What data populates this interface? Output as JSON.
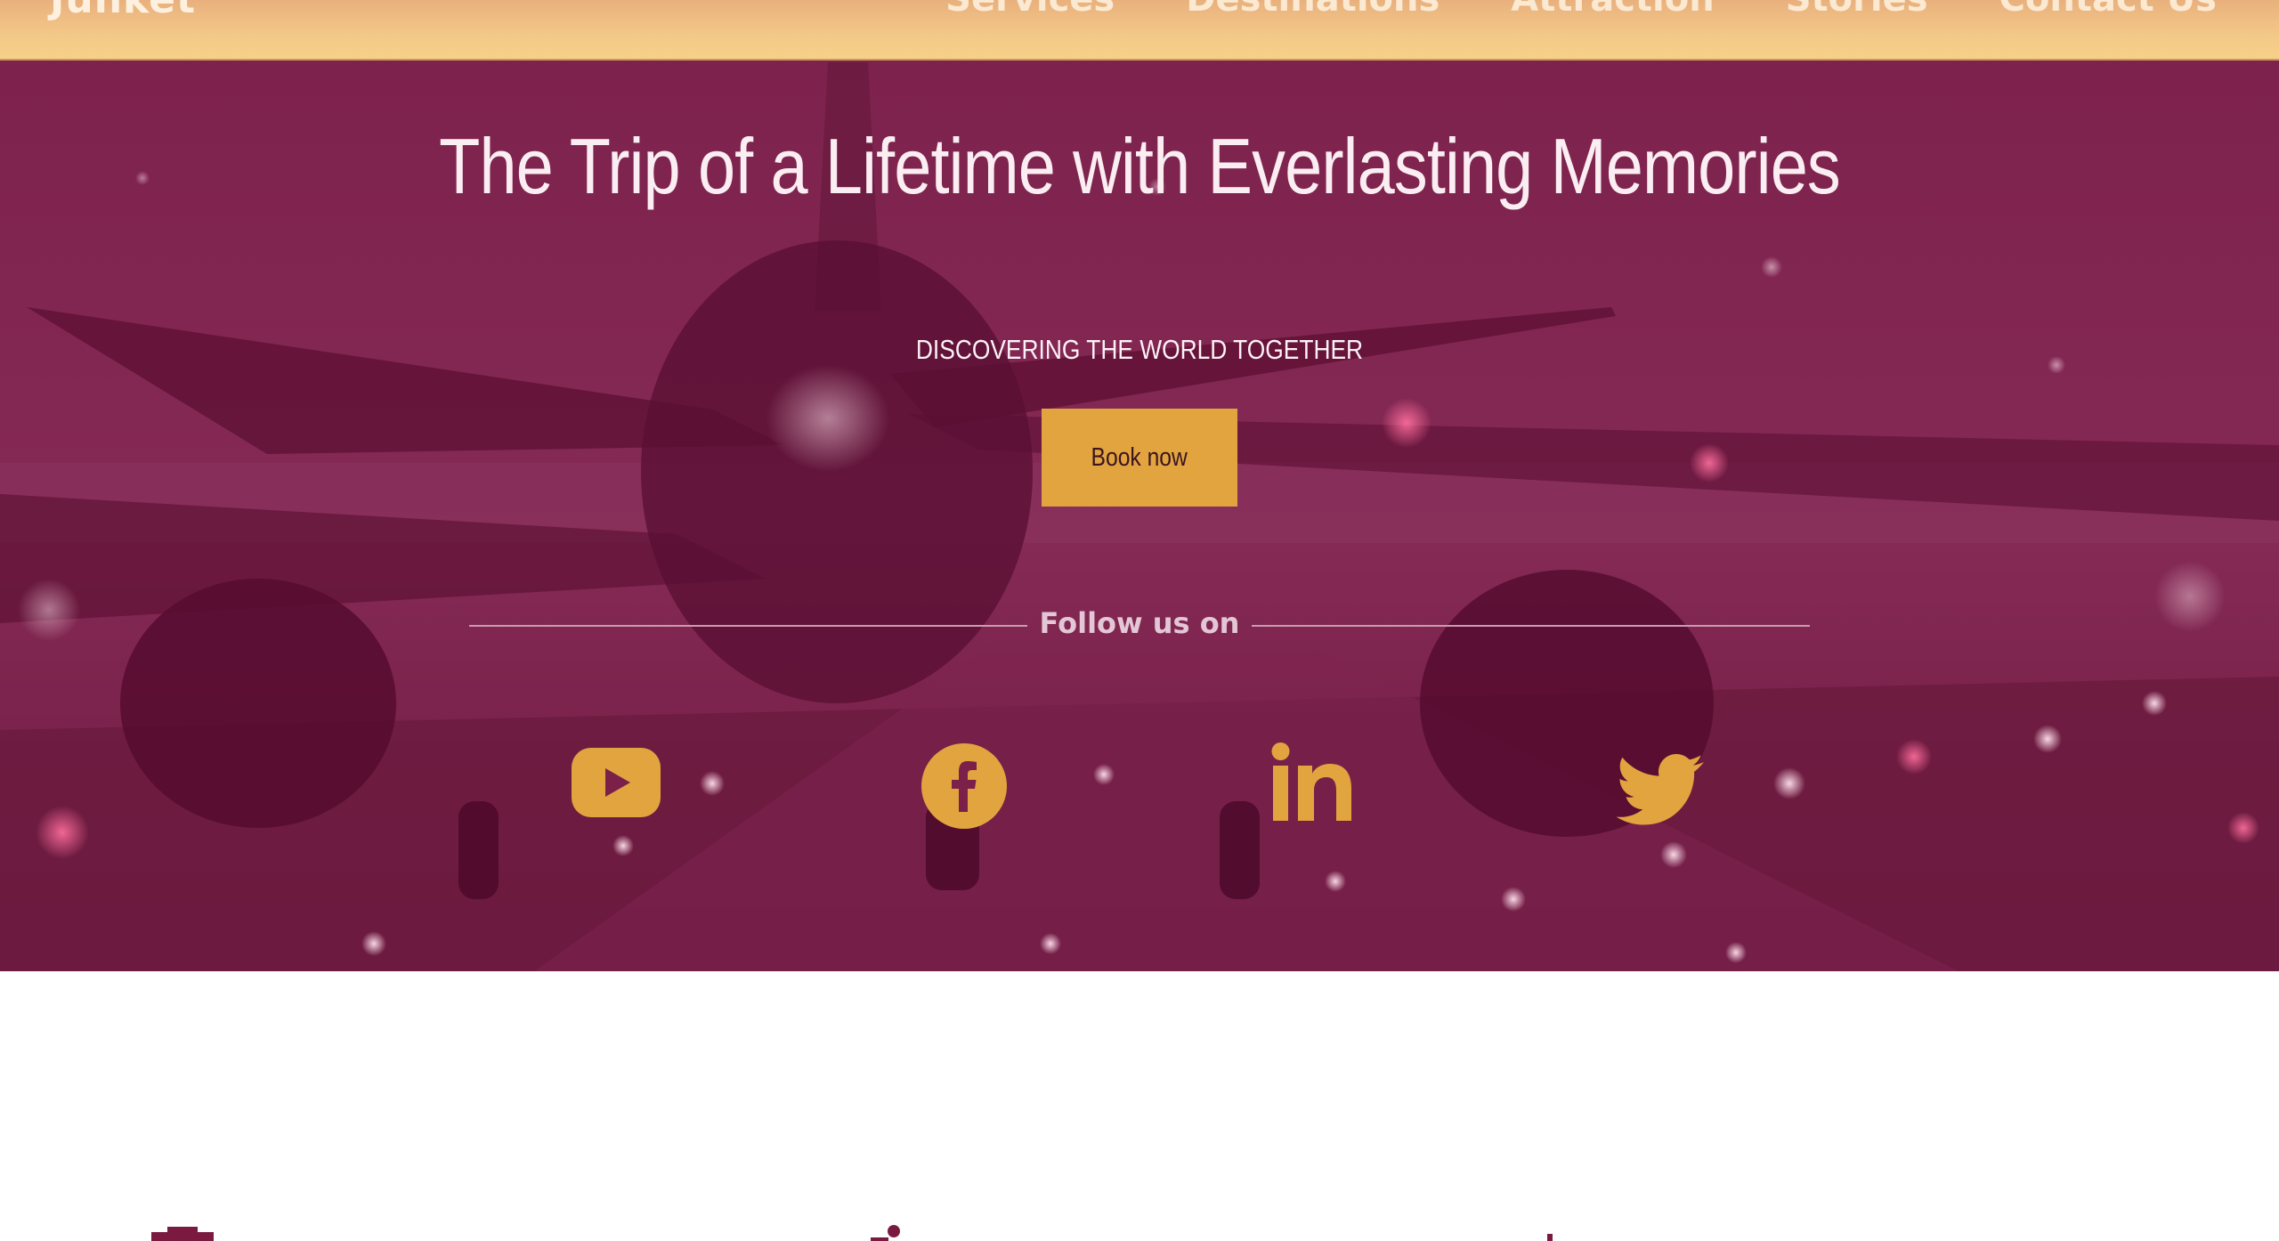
{
  "navbar": {
    "brand": "Junket",
    "links": [
      "Services",
      "Destinations",
      "Attraction",
      "Stories",
      "Contact Us"
    ]
  },
  "hero": {
    "title": "The Trip of a Lifetime with Everlasting Memories",
    "subtitle": "DISCOVERING THE WORLD TOGETHER",
    "cta_label": "Book now",
    "follow_label": "Follow us on"
  },
  "social": [
    {
      "icon": "youtube-icon"
    },
    {
      "icon": "facebook-icon"
    },
    {
      "icon": "linkedin-icon"
    },
    {
      "icon": "twitter-icon"
    }
  ],
  "colors": {
    "hero_overlay": "#7a2049",
    "accent_gold": "#e2a43f",
    "navbar": "#f3c888",
    "brand_maroon": "#7a1a40"
  }
}
